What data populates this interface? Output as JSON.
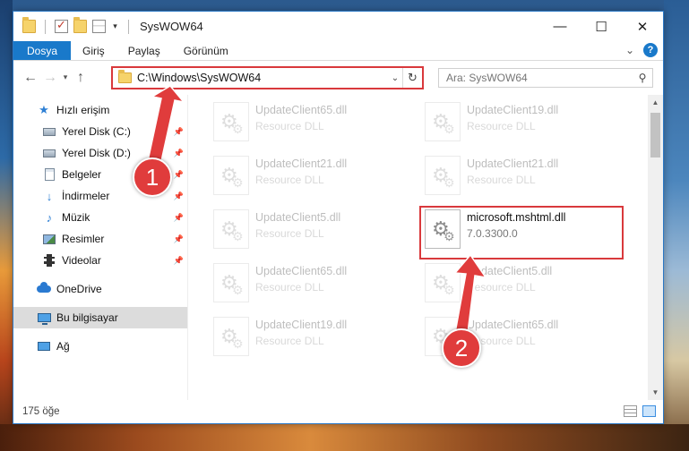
{
  "window": {
    "title": "SysWOW64",
    "controls": {
      "minimize": "—",
      "maximize": "☐",
      "close": "✕"
    }
  },
  "ribbon": {
    "tabs": [
      {
        "label": "Dosya",
        "active": true
      },
      {
        "label": "Giriş"
      },
      {
        "label": "Paylaş"
      },
      {
        "label": "Görünüm"
      }
    ],
    "help": "?"
  },
  "navbar": {
    "address_path": "C:\\Windows\\SysWOW64",
    "search_placeholder": "Ara: SysWOW64"
  },
  "nav_pane": {
    "quick_access": "Hızlı erişim",
    "items": [
      {
        "label": "Yerel Disk (C:)",
        "icon": "drive-icon",
        "pinned": true
      },
      {
        "label": "Yerel Disk (D:)",
        "icon": "drive-icon",
        "pinned": true
      },
      {
        "label": "Belgeler",
        "icon": "documents-icon",
        "pinned": true
      },
      {
        "label": "İndirmeler",
        "icon": "download-icon",
        "pinned": true
      },
      {
        "label": "Müzik",
        "icon": "music-icon",
        "pinned": true
      },
      {
        "label": "Resimler",
        "icon": "pictures-icon",
        "pinned": true
      },
      {
        "label": "Videolar",
        "icon": "videos-icon",
        "pinned": true
      }
    ],
    "onedrive": "OneDrive",
    "this_pc": "Bu bilgisayar",
    "network": "Ağ"
  },
  "files": [
    {
      "name": "UpdateClient65.dll",
      "sub": "Resource DLL",
      "faded": true
    },
    {
      "name": "UpdateClient19.dll",
      "sub": "Resource DLL",
      "faded": true
    },
    {
      "name": "UpdateClient21.dll",
      "sub": "Resource DLL",
      "faded": true
    },
    {
      "name": "UpdateClient21.dll",
      "sub": "Resource DLL",
      "faded": true
    },
    {
      "name": "UpdateClient5.dll",
      "sub": "Resource DLL",
      "faded": true
    },
    {
      "name": "microsoft.mshtml.dll",
      "sub": "7.0.3300.0",
      "faded": false
    },
    {
      "name": "UpdateClient65.dll",
      "sub": "Resource DLL",
      "faded": true
    },
    {
      "name": "UpdateClient5.dll",
      "sub": "Resource DLL",
      "faded": true
    },
    {
      "name": "UpdateClient19.dll",
      "sub": "Resource DLL",
      "faded": true
    },
    {
      "name": "UpdateClient65.dll",
      "sub": "Resource DLL",
      "faded": true
    }
  ],
  "status": {
    "item_count": "175 öğe"
  },
  "annotations": {
    "step1": "1",
    "step2": "2",
    "highlight_color": "#d9393c"
  }
}
